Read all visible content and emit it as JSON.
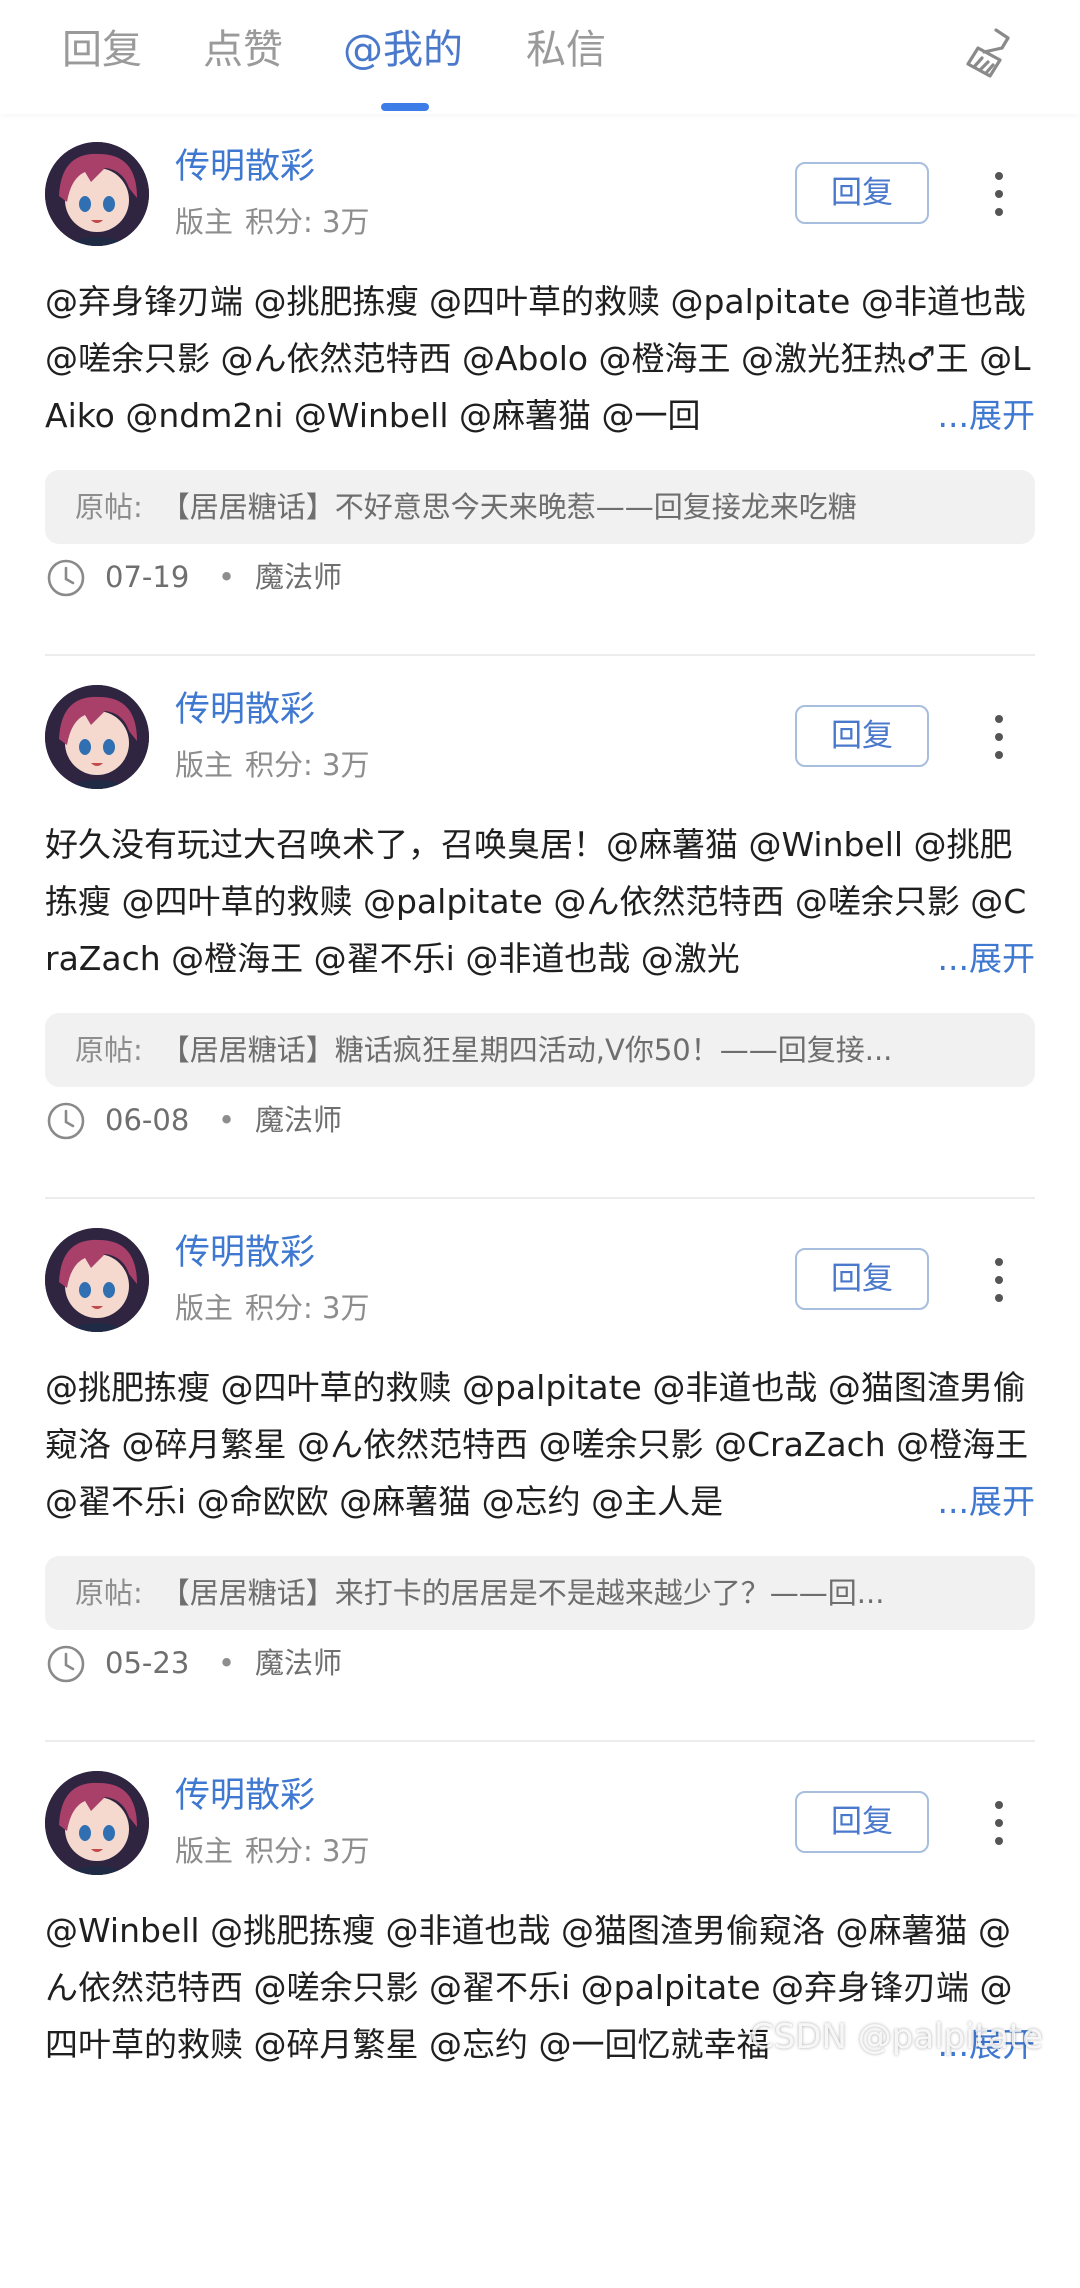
{
  "tabs": [
    {
      "label": "回复"
    },
    {
      "label": "点赞"
    },
    {
      "label": "@我的"
    },
    {
      "label": "私信"
    }
  ],
  "active_tab": "@我的",
  "clean_icon": "broom-icon",
  "colors": {
    "accent": "#3f78d0",
    "indicator": "#3d7de8",
    "text": "#1f1f1f",
    "muted": "#8d8d8d",
    "quote_bg": "#f1f1f1"
  },
  "orig_label": "原帖:",
  "expand_label": "...展开",
  "reply_label": "回复",
  "items": [
    {
      "user": "传明散彩",
      "role": "版主",
      "points": "积分: 3万",
      "content": "@弃身锋刃端 @挑肥拣瘦 @四叶草的救赎 @palpitate @非道也哉 @嗟余只影 @ん依然范特西 @Abolo @橙海王 @激光狂热♂王 @LAiko @ndm2ni @Winbell @麻薯猫 @一回",
      "orig": "【居居糖话】不好意思今天来晚惹——回复接龙来吃糖",
      "date": "07-19",
      "level": "魔法师"
    },
    {
      "user": "传明散彩",
      "role": "版主",
      "points": "积分: 3万",
      "content": "好久没有玩过大召唤术了，召唤臭居！@麻薯猫 @Winbell @挑肥拣瘦 @四叶草的救赎 @palpitate @ん依然范特西 @嗟余只影 @CraZach @橙海王 @翟不乐i @非道也哉 @激光",
      "orig": "【居居糖话】糖话疯狂星期四活动,V你50！——回复接...",
      "date": "06-08",
      "level": "魔法师"
    },
    {
      "user": "传明散彩",
      "role": "版主",
      "points": "积分: 3万",
      "content": "@挑肥拣瘦 @四叶草的救赎 @palpitate @非道也哉 @猫图渣男偷窥洛 @碎月繁星 @ん依然范特西 @嗟余只影 @CraZach @橙海王 @翟不乐i @命欧欧 @麻薯猫 @忘约 @主人是",
      "orig": "【居居糖话】来打卡的居居是不是越来越少了？——回...",
      "date": "05-23",
      "level": "魔法师"
    },
    {
      "user": "传明散彩",
      "role": "版主",
      "points": "积分: 3万",
      "content": "@Winbell @挑肥拣瘦 @非道也哉 @猫图渣男偷窥洛 @麻薯猫 @ん依然范特西 @嗟余只影 @翟不乐i @palpitate @弃身锋刃端 @四叶草的救赎 @碎月繁星 @忘约 @一回忆就幸福",
      "orig": "",
      "date": "",
      "level": ""
    }
  ],
  "watermark": "CSDN @palpitate"
}
